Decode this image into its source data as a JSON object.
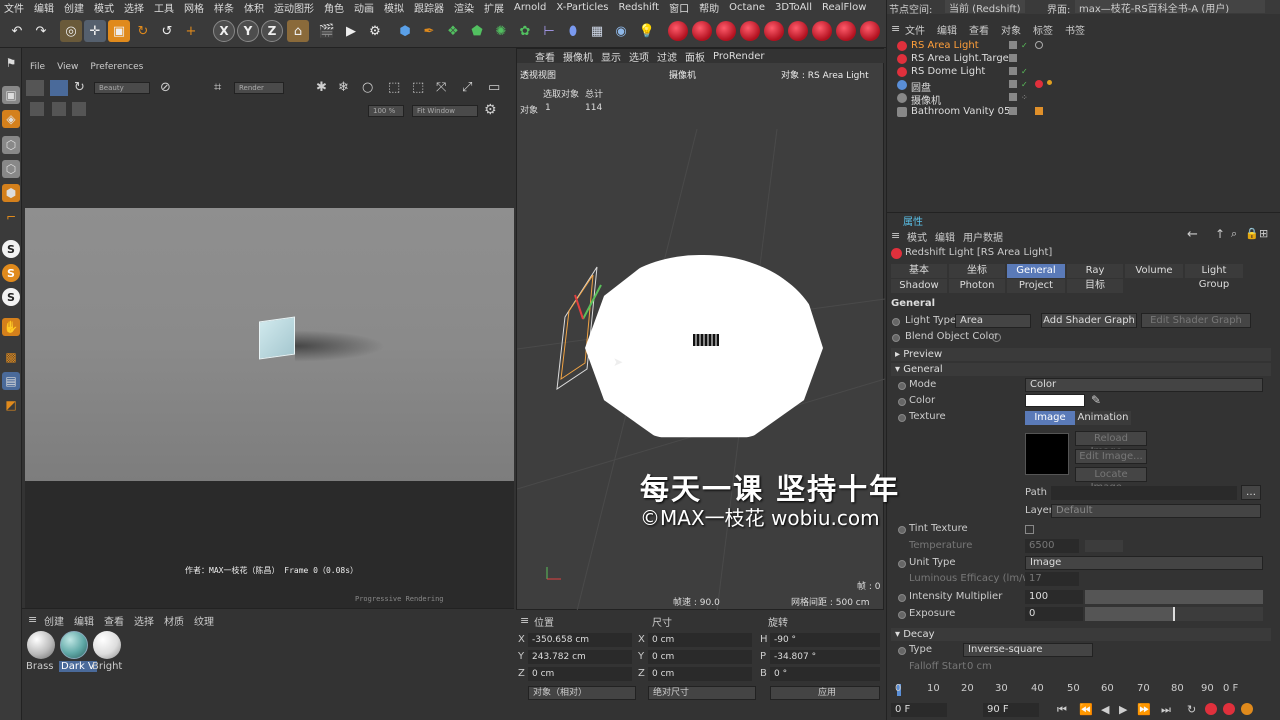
{
  "menubar": [
    "文件",
    "编辑",
    "创建",
    "模式",
    "选择",
    "工具",
    "网格",
    "样条",
    "体积",
    "运动图形",
    "角色",
    "动画",
    "模拟",
    "跟踪器",
    "渲染",
    "扩展",
    "Arnold",
    "X-Particles",
    "Redshift",
    "窗口",
    "帮助",
    "Octane",
    "3DToAll",
    "RealFlow"
  ],
  "toolbar": {
    "xyz": [
      "X",
      "Y",
      "Z"
    ]
  },
  "render_view": {
    "menu": [
      "File",
      "View",
      "Preferences"
    ],
    "beauty_label": "Beauty",
    "render_label": "Render",
    "zoom": "100 %",
    "fit": "Fit Window",
    "caption": "作者：MAX一枝花（陈昌） Frame 0（0.08s）",
    "progress": "Progressive Rendering"
  },
  "materials": {
    "menu": [
      "创建",
      "编辑",
      "查看",
      "选择",
      "材质",
      "纹理"
    ],
    "items": [
      {
        "name": "Brass",
        "color": "#e8e8e8"
      },
      {
        "name": "Dark V",
        "color": "#5fa8a6"
      },
      {
        "name": "Bright",
        "color": "#f0f0f0"
      }
    ]
  },
  "viewport": {
    "menu": [
      "查看",
      "摄像机",
      "显示",
      "选项",
      "过滤",
      "面板",
      "ProRender"
    ],
    "view_name": "透视视图",
    "camera": "摄像机",
    "object_label": "对象 : RS Area Light",
    "stats_header": [
      "选取对象",
      "总计"
    ],
    "stats_row_label": "对象",
    "stats_selected": "1",
    "stats_total": "114",
    "frame_rate": "帧速 : 90.0",
    "grid": "网格间距 : 500 cm",
    "frame": "帧 : 0"
  },
  "coords": {
    "headers": [
      "位置",
      "尺寸",
      "旋转"
    ],
    "pos": [
      {
        "axis": "X",
        "value": "-350.658 cm"
      },
      {
        "axis": "Y",
        "value": "243.782 cm"
      },
      {
        "axis": "Z",
        "value": "0 cm"
      }
    ],
    "size": [
      {
        "axis": "X",
        "value": "0 cm"
      },
      {
        "axis": "Y",
        "value": "0 cm"
      },
      {
        "axis": "Z",
        "value": "0 cm"
      }
    ],
    "rot": [
      {
        "axis": "H",
        "value": "-90 °"
      },
      {
        "axis": "P",
        "value": "-34.807 °"
      },
      {
        "axis": "B",
        "value": "0 °"
      }
    ],
    "mode": "对象（相对）",
    "size_mode": "绝对尺寸",
    "apply": "应用"
  },
  "object_manager": {
    "node_space_label": "节点空间:",
    "node_space": "当前 (Redshift)",
    "layout_label": "界面:",
    "layout": "max—枝花-RS百科全书-A (用户)",
    "menu": [
      "文件",
      "编辑",
      "查看",
      "对象",
      "标签",
      "书签"
    ],
    "objects": [
      {
        "name": "RS Area Light",
        "selected": true,
        "icon_color": "#e0303c"
      },
      {
        "name": "RS Area Light.Target",
        "selected": false,
        "icon_color": "#e0303c"
      },
      {
        "name": "RS Dome Light",
        "selected": false,
        "icon_color": "#e0303c"
      },
      {
        "name": "圆盘",
        "selected": false,
        "icon_color": "#5a8fd8"
      },
      {
        "name": "摄像机",
        "selected": false,
        "icon_color": "#888888"
      },
      {
        "name": "Bathroom Vanity 05",
        "selected": false,
        "icon_color": "#888888"
      }
    ]
  },
  "attributes": {
    "title": "属性",
    "menu": [
      "模式",
      "编辑",
      "用户数据"
    ],
    "object_title": "Redshift Light [RS Area Light]",
    "tabs_row1": [
      "基本",
      "坐标",
      "General",
      "Ray",
      "Volume",
      "Light Group"
    ],
    "tabs_row2": [
      "Shadow",
      "Photon",
      "Project",
      "目标"
    ],
    "active_tab": "General",
    "section_general": "General",
    "light_type_label": "Light Type",
    "light_type": "Area",
    "add_shader_graph": "Add Shader Graph",
    "edit_shader_graph": "Edit Shader Graph",
    "blend_object_color": "Blend Object Color",
    "preview_section": "Preview",
    "general_section": "General",
    "mode_label": "Mode",
    "mode_value": "Color",
    "color_label": "Color",
    "color_value": "#ffffff",
    "texture_label": "Texture",
    "image_tab": "Image",
    "animation_tab": "Animation",
    "reload_image": "Reload Image...",
    "edit_image": "Edit Image...",
    "locate_image": "Locate Image...",
    "path_label": "Path",
    "layer_label": "Layer",
    "layer_value": "Default",
    "tint_texture": "Tint Texture",
    "temperature_label": "Temperature",
    "temperature_value": "6500",
    "unit_type_label": "Unit Type",
    "unit_type_value": "Image",
    "luminous_label": "Luminous Efficacy (lm/w)",
    "luminous_value": "17",
    "intensity_label": "Intensity Multiplier",
    "intensity_value": "100",
    "exposure_label": "Exposure",
    "exposure_value": "0",
    "decay_section": "Decay",
    "decay_type_label": "Type",
    "decay_type_value": "Inverse-square",
    "falloff_label": "Falloff Start",
    "falloff_value": "0 cm"
  },
  "timeline": {
    "ticks": [
      "0",
      "10",
      "20",
      "30",
      "40",
      "50",
      "60",
      "70",
      "80",
      "90"
    ],
    "current": "0 F",
    "start": "0 F",
    "end": "90 F"
  },
  "watermark": {
    "line1": "每天一课 坚持十年",
    "line2": "©MAX一枝花 wobiu.com"
  }
}
